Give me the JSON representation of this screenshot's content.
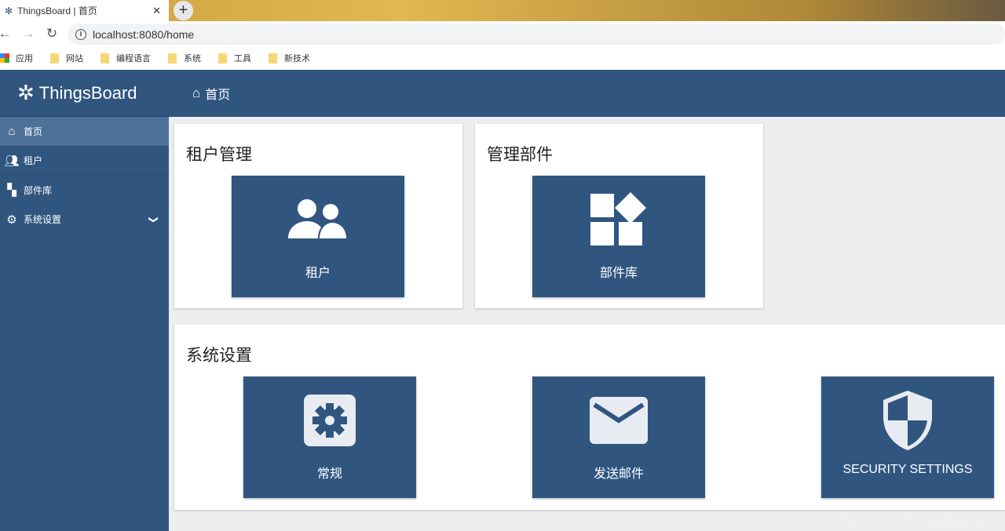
{
  "browser": {
    "tab_title": "ThingsBoard | 首页",
    "url": "localhost:8080/home",
    "bookmarks": [
      "应用",
      "网站",
      "编程语言",
      "系统",
      "工具",
      "新技术"
    ]
  },
  "app": {
    "brand": "ThingsBoard",
    "page_title": "首页",
    "sidebar": [
      {
        "label": "首页",
        "icon": "home-icon"
      },
      {
        "label": "租户",
        "icon": "people-icon"
      },
      {
        "label": "部件库",
        "icon": "widgets-icon"
      },
      {
        "label": "系统设置",
        "icon": "gear-icon"
      }
    ],
    "cards": {
      "tenants": {
        "title": "租户管理",
        "tile": "租户"
      },
      "widgets": {
        "title": "管理部件",
        "tile": "部件库"
      },
      "settings": {
        "title": "系统设置",
        "tiles": [
          "常规",
          "发送邮件",
          "SECURITY SETTINGS"
        ]
      }
    }
  },
  "watermark": "https://blog.csdn.net/qq_21454973"
}
